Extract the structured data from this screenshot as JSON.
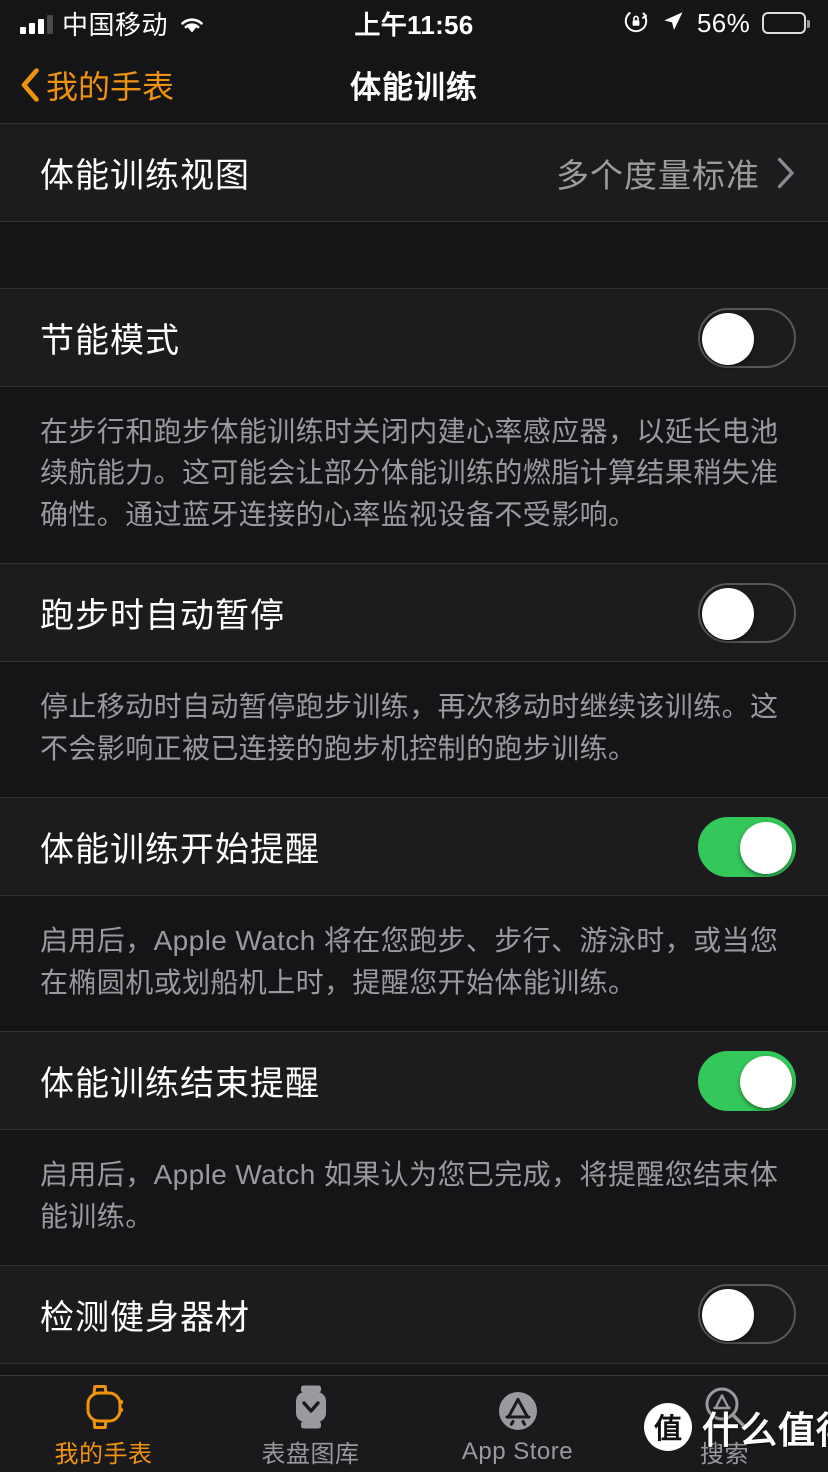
{
  "status_bar": {
    "carrier": "中国移动",
    "time": "上午11:56",
    "battery_percent": "56%",
    "battery_level": 56,
    "signal_bars_filled": 3,
    "signal_bars_total": 4,
    "icons": [
      "cellular-signal-icon",
      "wifi-icon",
      "rotation-lock-icon",
      "location-arrow-icon",
      "battery-icon"
    ]
  },
  "nav_bar": {
    "back_label": "我的手表",
    "title": "体能训练",
    "accent_color": "#F0930C"
  },
  "rows": {
    "workout_view": {
      "label": "体能训练视图",
      "value": "多个度量标准"
    },
    "power_saving": {
      "label": "节能模式",
      "toggle": "off",
      "footer": "在步行和跑步体能训练时关闭内建心率感应器，以延长电池续航能力。这可能会让部分体能训练的燃脂计算结果稍失准确性。通过蓝牙连接的心率监视设备不受影响。"
    },
    "auto_pause": {
      "label": "跑步时自动暂停",
      "toggle": "off",
      "footer": "停止移动时自动暂停跑步训练，再次移动时继续该训练。这不会影响正被已连接的跑步机控制的跑步训练。"
    },
    "start_reminder": {
      "label": "体能训练开始提醒",
      "toggle": "on",
      "footer": "启用后，Apple Watch 将在您跑步、步行、游泳时，或当您在椭圆机或划船机上时，提醒您开始体能训练。"
    },
    "end_reminder": {
      "label": "体能训练结束提醒",
      "toggle": "on",
      "footer": "启用后，Apple Watch 如果认为您已完成，将提醒您结束体能训练。"
    },
    "detect_equipment": {
      "label": "检测健身器材",
      "toggle": "off"
    }
  },
  "tab_bar": {
    "items": [
      {
        "label": "我的手表",
        "icon": "watch-outline-icon",
        "active": true
      },
      {
        "label": "表盘图库",
        "icon": "watch-face-icon",
        "active": false
      },
      {
        "label": "App Store",
        "icon": "app-store-icon",
        "active": false
      },
      {
        "label": "搜索",
        "icon": "search-appstore-icon",
        "active": false
      }
    ],
    "active_color": "#F0930C",
    "inactive_color": "#9A9A9E"
  },
  "watermark": {
    "badge": "值",
    "text": "什么值得买"
  },
  "colors": {
    "toggle_on": "#34C759",
    "row_background": "#1C1C1E",
    "page_background": "#151517",
    "separator": "#333336"
  }
}
